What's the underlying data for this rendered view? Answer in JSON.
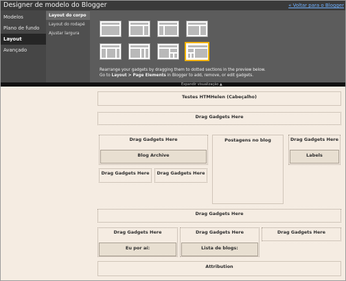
{
  "app": {
    "title": "Designer de modelo do Blogger",
    "back_link": "« Voltar para o Blogger"
  },
  "nav": {
    "items": [
      "Modelos",
      "Plano de fundo",
      "Layout",
      "Avançado"
    ],
    "active": "Layout"
  },
  "subnav": {
    "items": [
      "Layout do corpo",
      "Layout do rodapé",
      "Ajustar largura"
    ],
    "active": "Layout do corpo"
  },
  "layout_options": {
    "count": 8,
    "selected_index": 7
  },
  "description": {
    "line1": "Rearrange your gadgets by dragging them to dotted sections in the preview below.",
    "line2_prefix": "Go to ",
    "line2_bold": "Layout > Page Elements",
    "line2_suffix": " in Blogger to add, remove, or edit gadgets."
  },
  "expander": {
    "label": "Expandir visualização ▲"
  },
  "preview": {
    "header": "Testes HTMHelen (Cabeçalho)",
    "drag_here": "Drag Gadgets Here",
    "blog_archive": "Blog Archive",
    "posts": "Postagens no blog",
    "labels": "Labels",
    "eu_por_ai": "Eu por aí:",
    "lista_blogs": "Lista de blogs:",
    "attribution": "Attribution"
  },
  "colors": {
    "dark_bg": "#3a3a3a",
    "preview_bg": "#f5ece2",
    "selected_border": "#f5b400",
    "link": "#6fb0ff"
  }
}
